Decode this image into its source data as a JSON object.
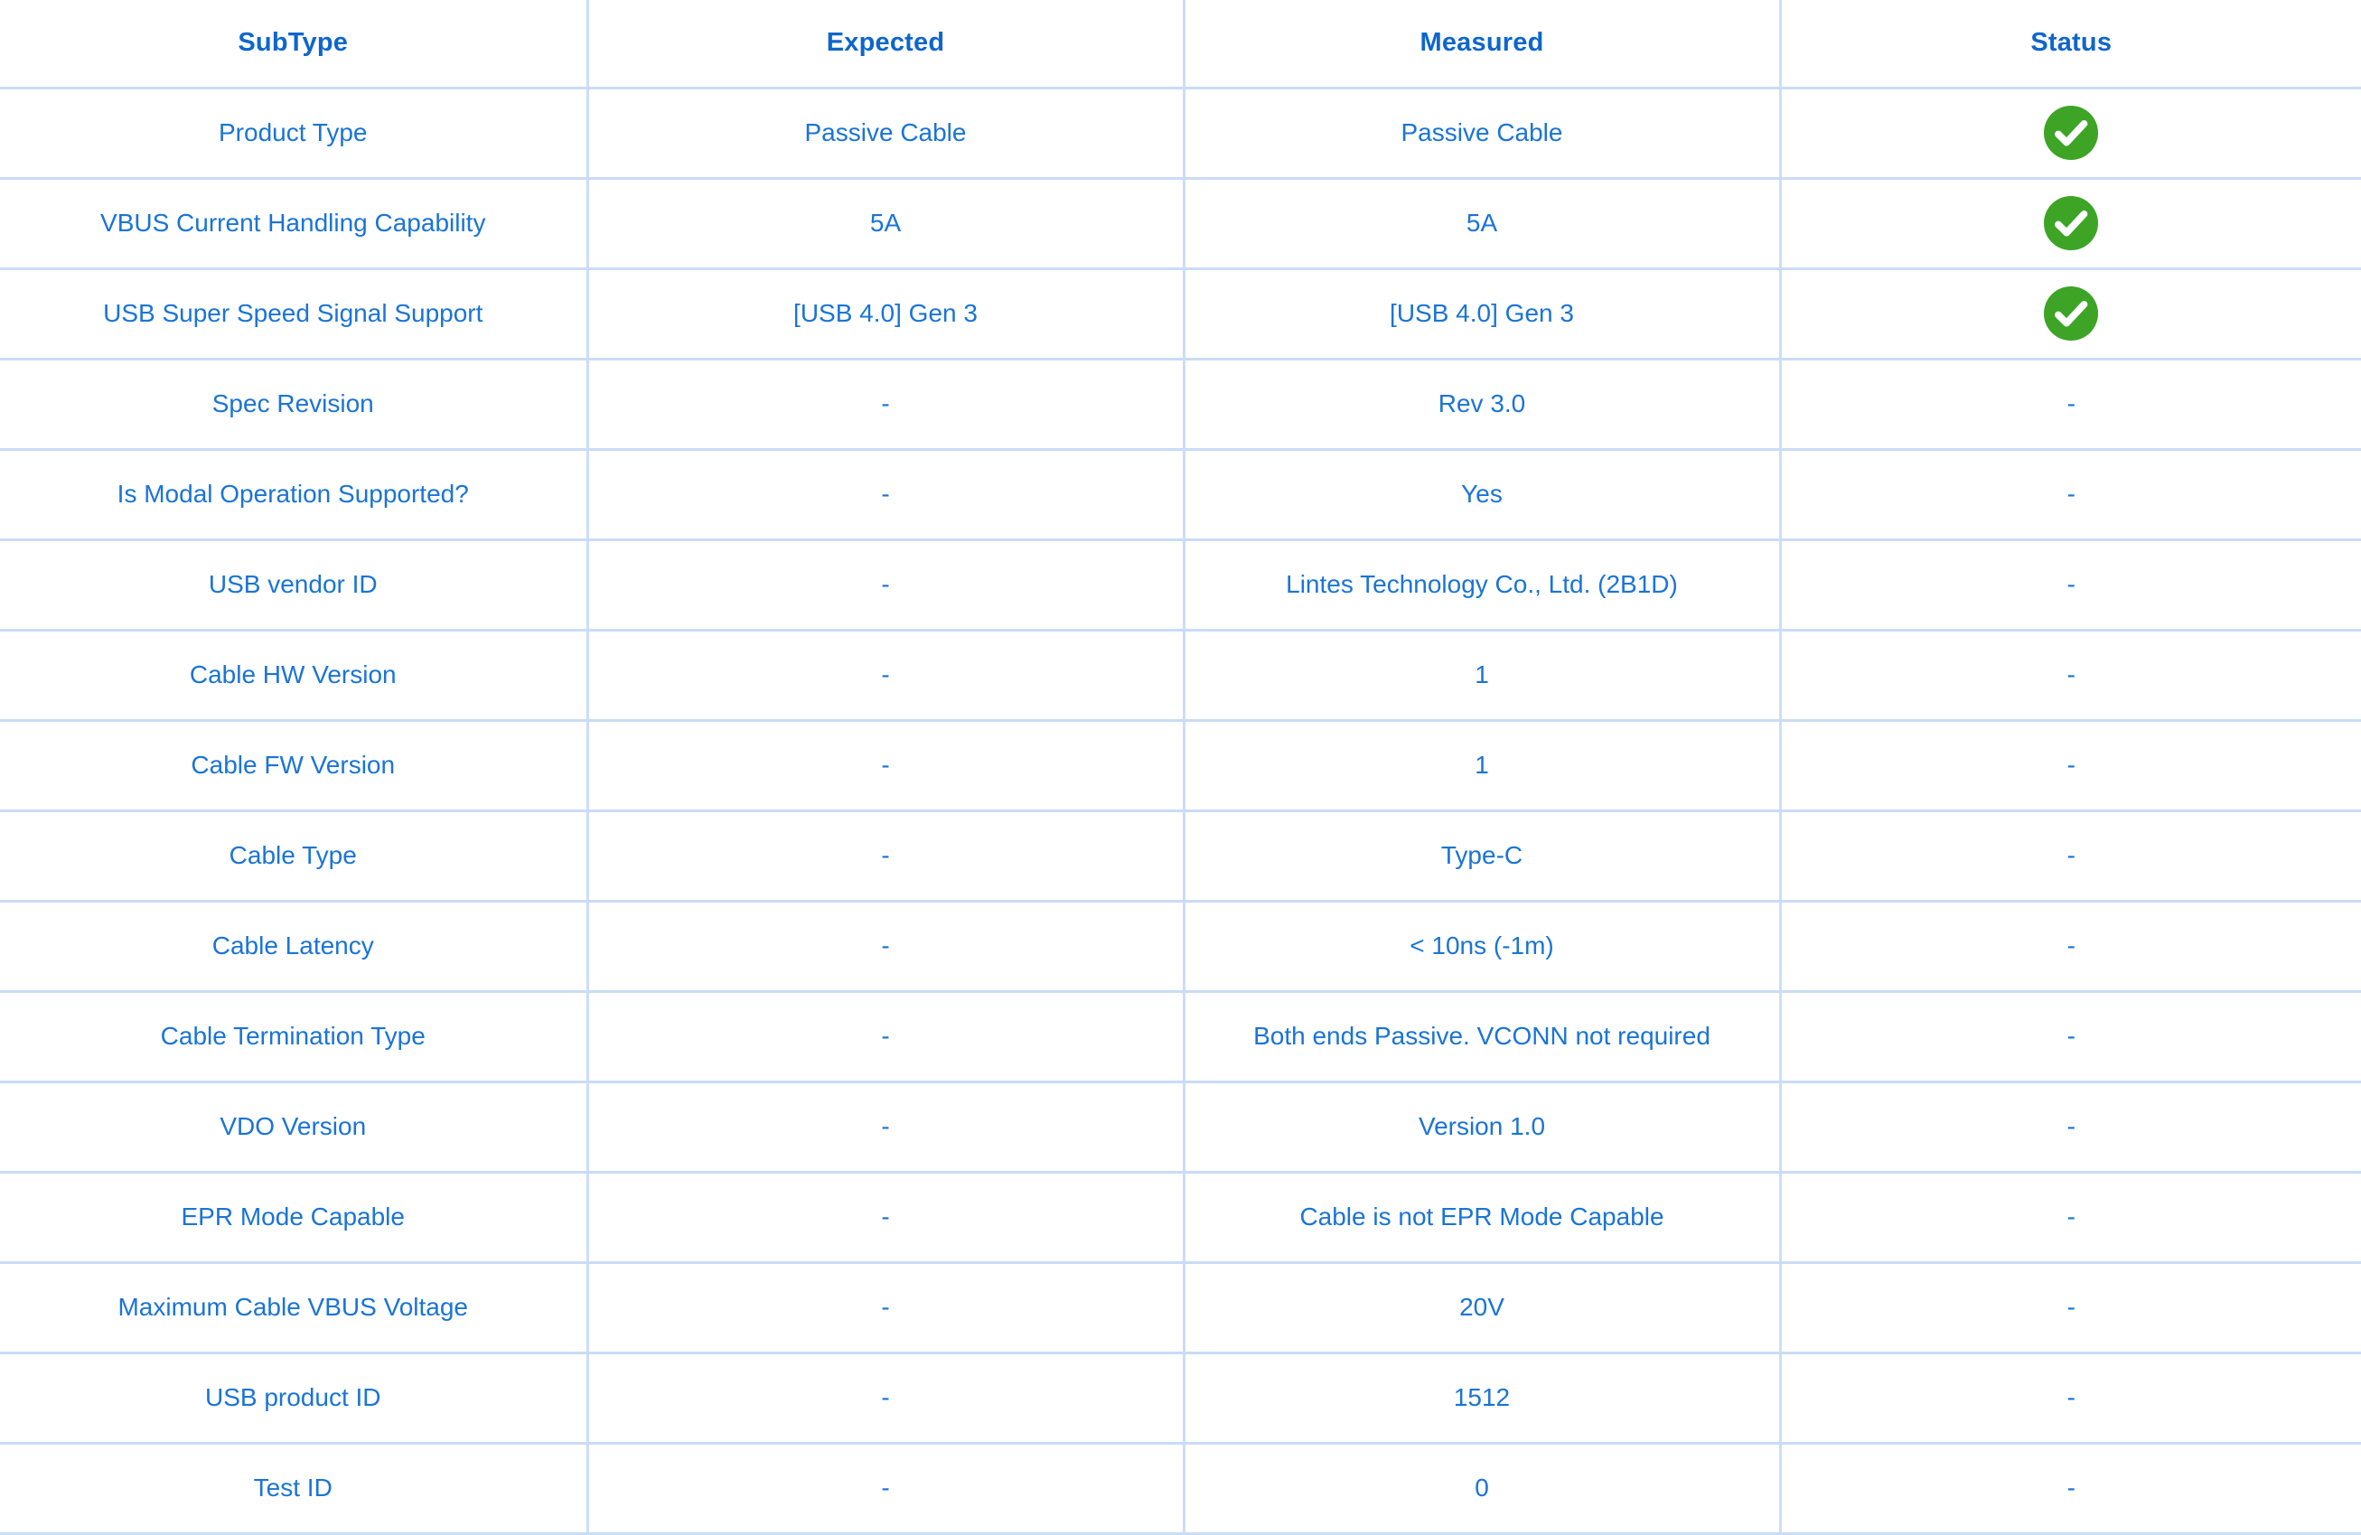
{
  "colors": {
    "header_text": "#0e66cb",
    "cell_text": "#1a74d6",
    "grid_line": "#c9dcf6",
    "status_pass_green": "#3da426",
    "background": "#ffffff"
  },
  "table": {
    "columns": [
      {
        "key": "subtype",
        "label": "SubType"
      },
      {
        "key": "expected",
        "label": "Expected"
      },
      {
        "key": "measured",
        "label": "Measured"
      },
      {
        "key": "status",
        "label": "Status"
      }
    ],
    "rows": [
      {
        "subtype": "Product Type",
        "expected": "Passive Cable",
        "measured": "Passive Cable",
        "status": "pass",
        "status_text": ""
      },
      {
        "subtype": "VBUS Current Handling Capability",
        "expected": "5A",
        "measured": "5A",
        "status": "pass",
        "status_text": ""
      },
      {
        "subtype": "USB Super Speed Signal Support",
        "expected": "[USB 4.0] Gen 3",
        "measured": "[USB 4.0] Gen 3",
        "status": "pass",
        "status_text": ""
      },
      {
        "subtype": "Spec Revision",
        "expected": "-",
        "measured": "Rev 3.0",
        "status": "none",
        "status_text": "-"
      },
      {
        "subtype": "Is Modal Operation Supported?",
        "expected": "-",
        "measured": "Yes",
        "status": "none",
        "status_text": "-"
      },
      {
        "subtype": "USB vendor ID",
        "expected": "-",
        "measured": "Lintes Technology Co., Ltd. (2B1D)",
        "status": "none",
        "status_text": "-"
      },
      {
        "subtype": "Cable HW Version",
        "expected": "-",
        "measured": "1",
        "status": "none",
        "status_text": "-"
      },
      {
        "subtype": "Cable FW Version",
        "expected": "-",
        "measured": "1",
        "status": "none",
        "status_text": "-"
      },
      {
        "subtype": "Cable Type",
        "expected": "-",
        "measured": "Type-C",
        "status": "none",
        "status_text": "-"
      },
      {
        "subtype": "Cable Latency",
        "expected": "-",
        "measured": "< 10ns (-1m)",
        "status": "none",
        "status_text": "-"
      },
      {
        "subtype": "Cable Termination Type",
        "expected": "-",
        "measured": "Both ends Passive. VCONN not required",
        "status": "none",
        "status_text": "-"
      },
      {
        "subtype": "VDO Version",
        "expected": "-",
        "measured": "Version 1.0",
        "status": "none",
        "status_text": "-"
      },
      {
        "subtype": "EPR Mode Capable",
        "expected": "-",
        "measured": "Cable is not EPR Mode Capable",
        "status": "none",
        "status_text": "-"
      },
      {
        "subtype": "Maximum Cable VBUS Voltage",
        "expected": "-",
        "measured": "20V",
        "status": "none",
        "status_text": "-"
      },
      {
        "subtype": "USB product ID",
        "expected": "-",
        "measured": "1512",
        "status": "none",
        "status_text": "-"
      },
      {
        "subtype": "Test ID",
        "expected": "-",
        "measured": "0",
        "status": "none",
        "status_text": "-"
      }
    ]
  },
  "icons": {
    "pass": "check-circle-icon"
  }
}
